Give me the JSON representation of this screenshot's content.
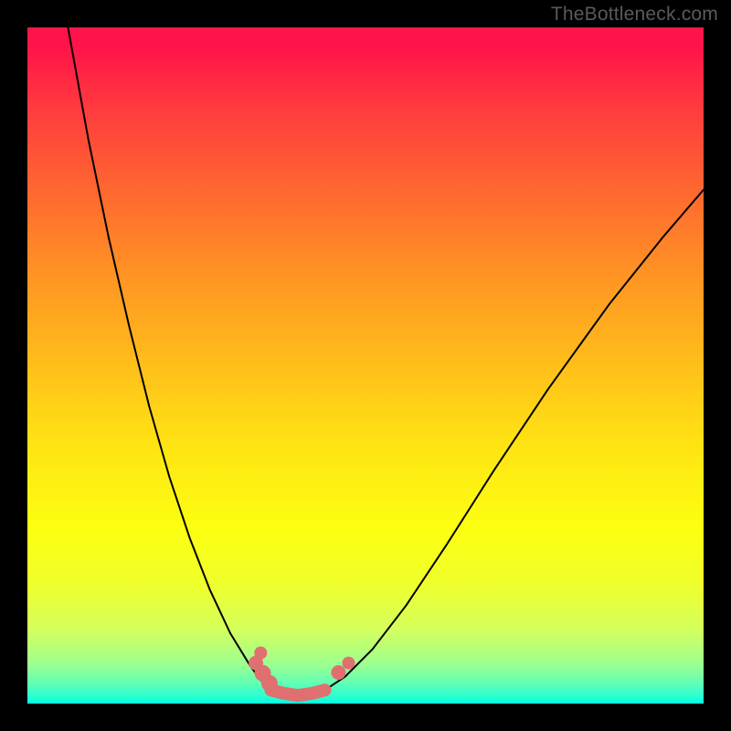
{
  "watermark": "TheBottleneck.com",
  "chart_data": {
    "type": "line",
    "title": "",
    "xlabel": "",
    "ylabel": "",
    "xlim": [
      0,
      1
    ],
    "ylim": [
      0,
      1
    ],
    "background_gradient_stops": [
      {
        "pos": 0.0,
        "color": "#ff1449"
      },
      {
        "pos": 0.12,
        "color": "#ff3b3e"
      },
      {
        "pos": 0.25,
        "color": "#ff6a2f"
      },
      {
        "pos": 0.37,
        "color": "#ff9523"
      },
      {
        "pos": 0.5,
        "color": "#ffbf1a"
      },
      {
        "pos": 0.62,
        "color": "#ffe413"
      },
      {
        "pos": 0.74,
        "color": "#fcff10"
      },
      {
        "pos": 0.82,
        "color": "#f0ff2a"
      },
      {
        "pos": 0.89,
        "color": "#d4ff5c"
      },
      {
        "pos": 0.94,
        "color": "#9fff8e"
      },
      {
        "pos": 0.97,
        "color": "#62ffb5"
      },
      {
        "pos": 0.99,
        "color": "#28ffd3"
      },
      {
        "pos": 1.0,
        "color": "#00ffe0"
      }
    ],
    "series": [
      {
        "name": "left-branch",
        "color": "#000000",
        "width": 2,
        "x": [
          0.06,
          0.09,
          0.12,
          0.15,
          0.18,
          0.21,
          0.24,
          0.27,
          0.3,
          0.33,
          0.345,
          0.36
        ],
        "y": [
          1.0,
          0.835,
          0.69,
          0.56,
          0.44,
          0.335,
          0.245,
          0.168,
          0.104,
          0.055,
          0.035,
          0.02
        ]
      },
      {
        "name": "right-branch",
        "color": "#000000",
        "width": 2,
        "x": [
          0.44,
          0.47,
          0.51,
          0.56,
          0.62,
          0.69,
          0.77,
          0.86,
          0.94,
          1.0
        ],
        "y": [
          0.02,
          0.04,
          0.08,
          0.145,
          0.235,
          0.345,
          0.465,
          0.59,
          0.69,
          0.76
        ]
      },
      {
        "name": "flat-valley",
        "color": "#e07070",
        "width": 14,
        "x": [
          0.36,
          0.38,
          0.4,
          0.42,
          0.44
        ],
        "y": [
          0.02,
          0.015,
          0.012,
          0.015,
          0.02
        ]
      }
    ],
    "markers": [
      {
        "name": "left-cluster-1",
        "x": 0.338,
        "y": 0.06,
        "r": 8,
        "color": "#e07070"
      },
      {
        "name": "left-cluster-2",
        "x": 0.348,
        "y": 0.045,
        "r": 9,
        "color": "#e07070"
      },
      {
        "name": "left-cluster-3",
        "x": 0.358,
        "y": 0.03,
        "r": 9,
        "color": "#e07070"
      },
      {
        "name": "left-cluster-4",
        "x": 0.345,
        "y": 0.075,
        "r": 7,
        "color": "#e07070"
      },
      {
        "name": "right-marker-1",
        "x": 0.46,
        "y": 0.046,
        "r": 8,
        "color": "#e07070"
      },
      {
        "name": "right-marker-2",
        "x": 0.475,
        "y": 0.06,
        "r": 7,
        "color": "#e07070"
      }
    ]
  }
}
